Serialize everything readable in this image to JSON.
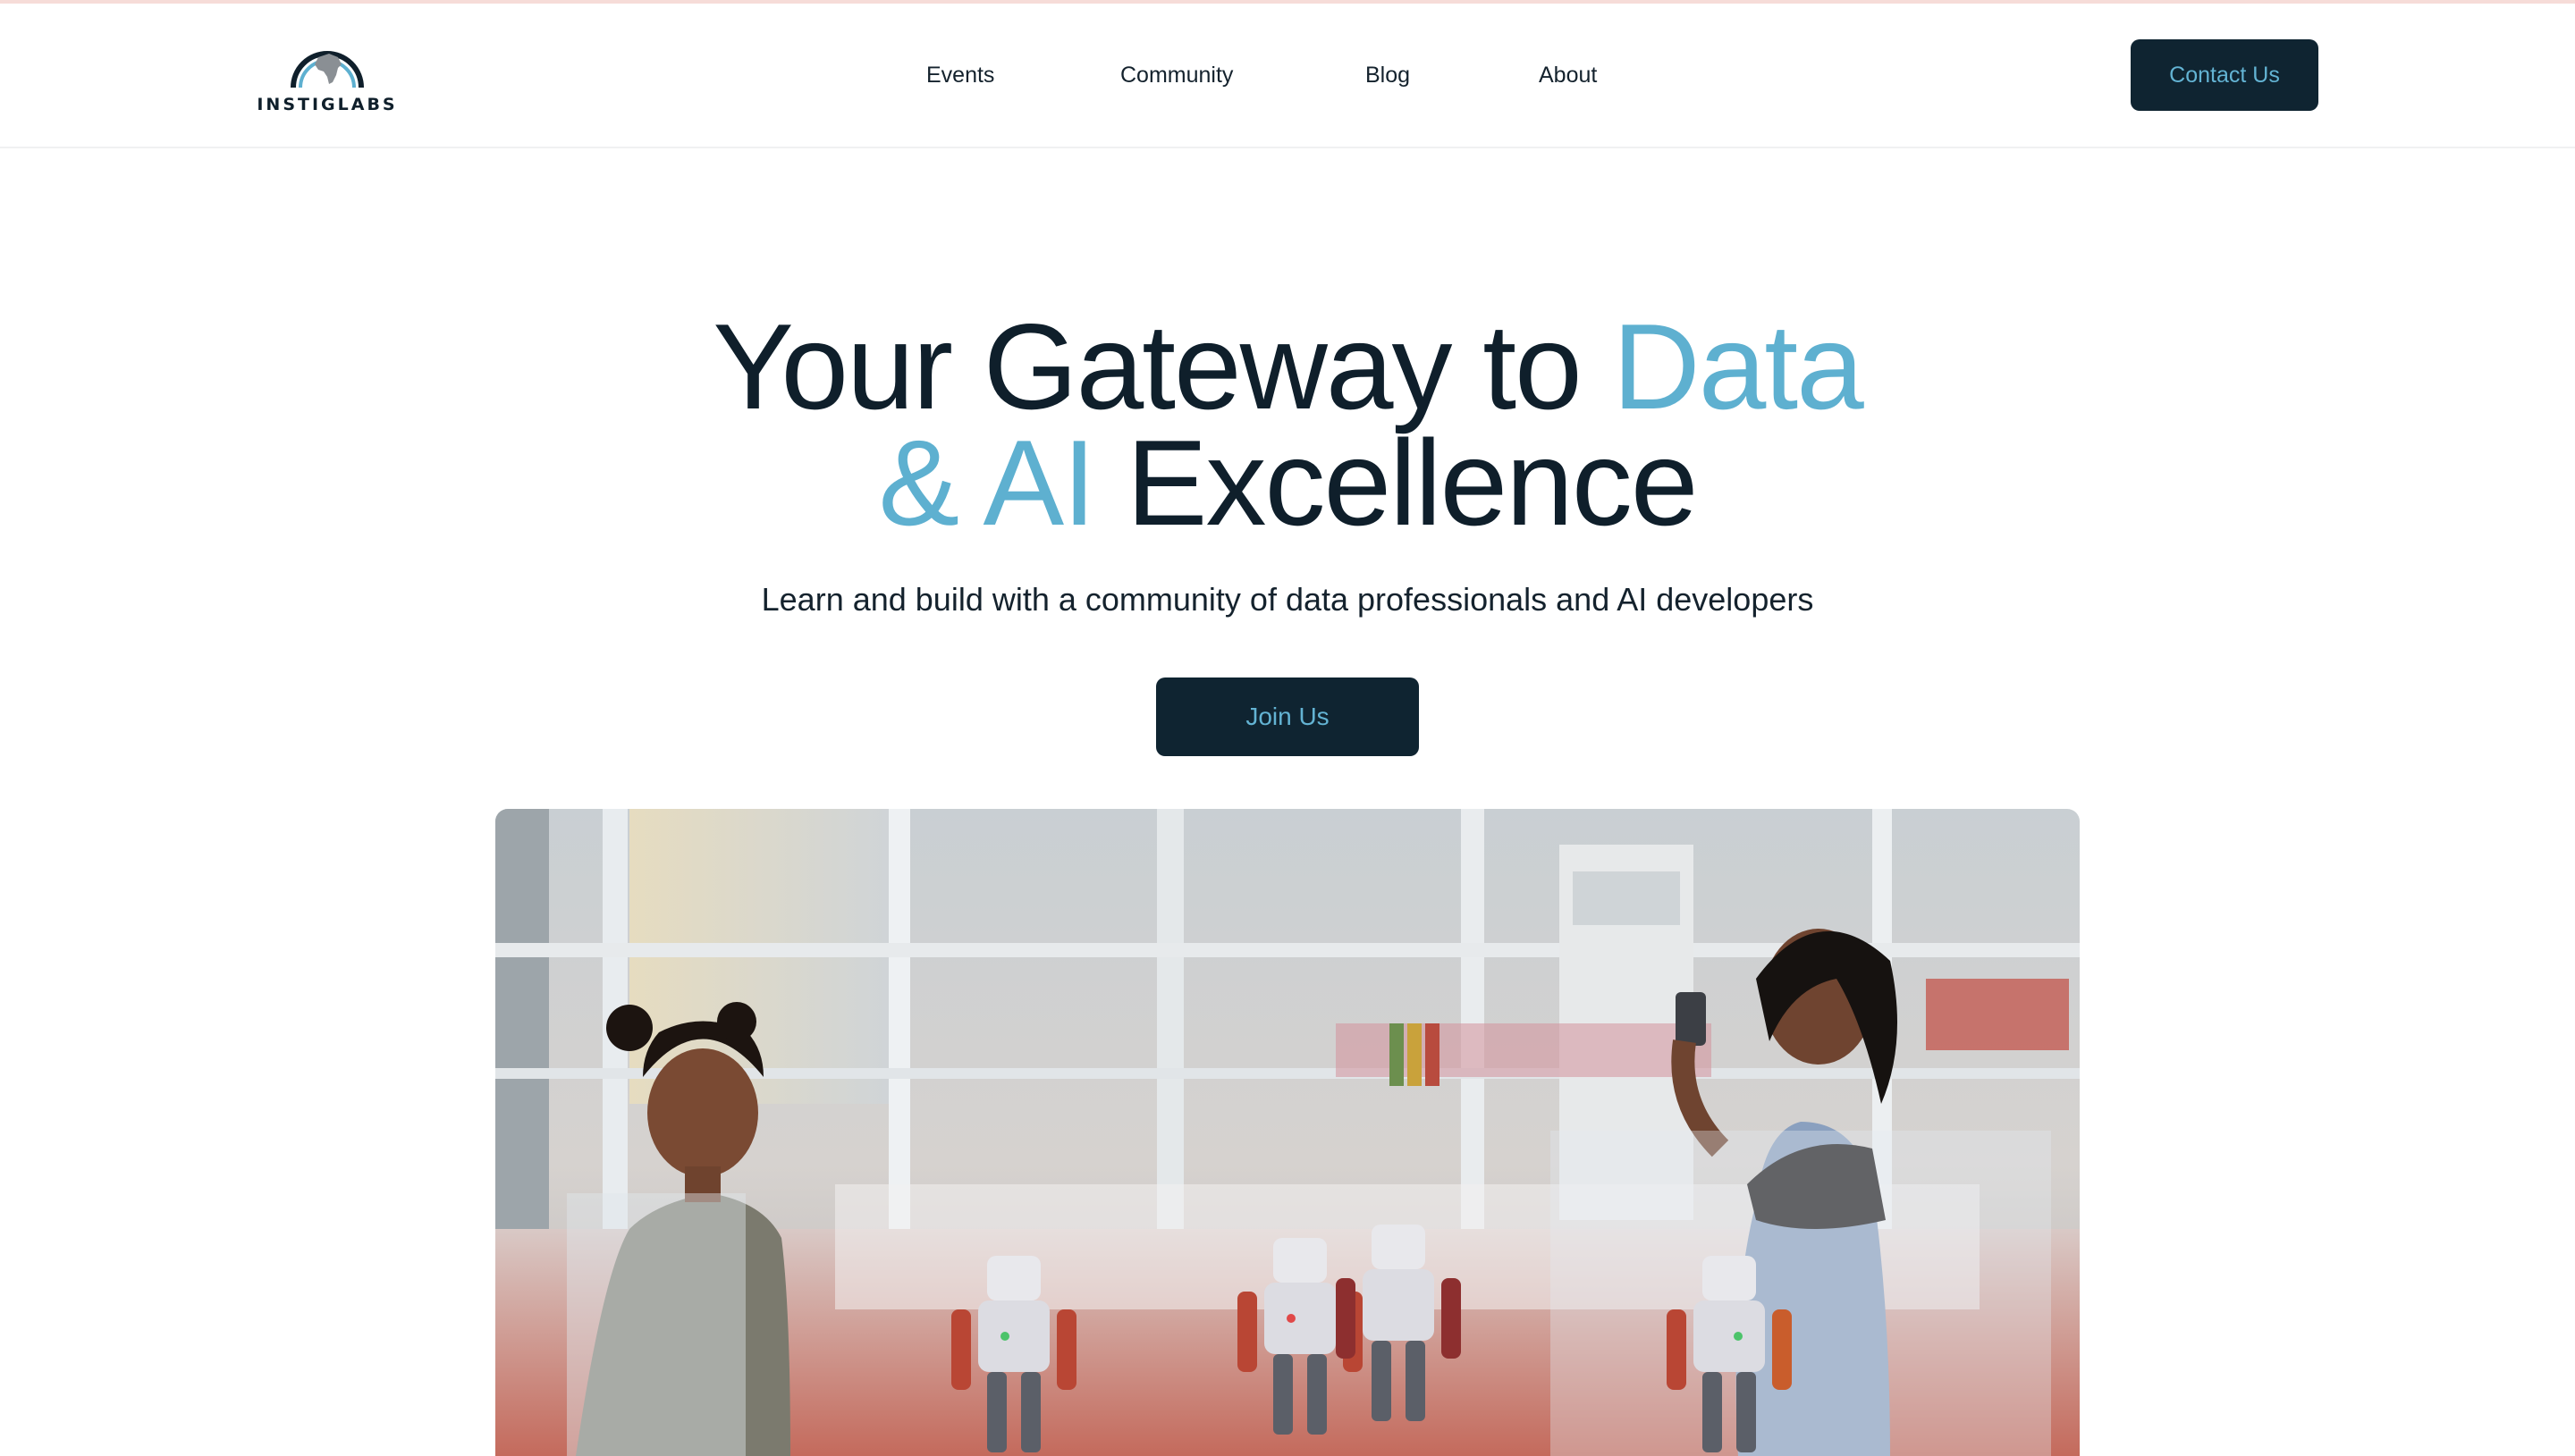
{
  "brand": {
    "logo_text": "INSTIGLABS",
    "logo_icon": "africa-globe-icon"
  },
  "nav": {
    "items": [
      {
        "label": "Events"
      },
      {
        "label": "Community"
      },
      {
        "label": "Blog"
      },
      {
        "label": "About"
      }
    ],
    "contact_label": "Contact Us"
  },
  "hero": {
    "title_part1": "Your Gateway to ",
    "title_accent1": "Data",
    "title_accent2": "& AI",
    "title_part2": " Excellence",
    "subtitle": "Learn and build with a community of data professionals and AI developers",
    "cta_label": "Join Us",
    "image_alt": "Young girl and woman watching small humanoid robots inside a glass enclosure"
  },
  "colors": {
    "dark": "#0f2431",
    "accent": "#5eb0d0",
    "top_stripe": "#f6dcd8"
  }
}
